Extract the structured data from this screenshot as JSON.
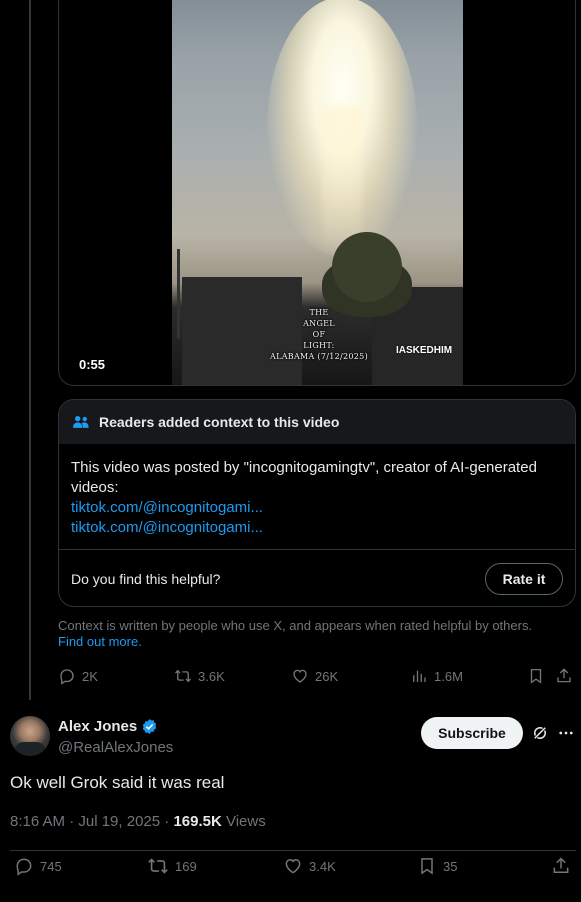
{
  "video": {
    "duration": "0:55",
    "caption_lines": [
      "THE",
      "ANGEL",
      "OF",
      "LIGHT:",
      "ALABAMA (7/12/2025)"
    ],
    "watermark": "IASKEDHIM"
  },
  "community_note": {
    "header": "Readers added context to this video",
    "body": "This video was posted by \"incognitogamingtv\", creator of AI-generated videos:",
    "links": [
      "tiktok.com/@incognitogami...",
      "tiktok.com/@incognitogami..."
    ],
    "helpful_question": "Do you find this helpful?",
    "rate_button": "Rate it"
  },
  "context_disclaimer": {
    "text": "Context is written by people who use X, and appears when rated helpful by others.",
    "link": "Find out more."
  },
  "quoted_post_actions": {
    "replies": "2K",
    "reposts": "3.6K",
    "likes": "26K",
    "views": "1.6M"
  },
  "post": {
    "author_name": "Alex Jones",
    "handle": "@RealAlexJones",
    "subscribe_label": "Subscribe",
    "text": "Ok well Grok said it was real",
    "timestamp": "8:16 AM · Jul 19, 2025 · ",
    "views_count": "169.5K",
    "views_label": " Views"
  },
  "post_actions": {
    "replies": "745",
    "reposts": "169",
    "likes": "3.4K",
    "bookmarks": "35"
  },
  "colors": {
    "background": "#000000",
    "text": "#e7e9ea",
    "muted": "#71767b",
    "link": "#1d9bf0",
    "verified": "#1d9bf0",
    "note_header_bg": "#16181c",
    "border": "#2f3336"
  }
}
